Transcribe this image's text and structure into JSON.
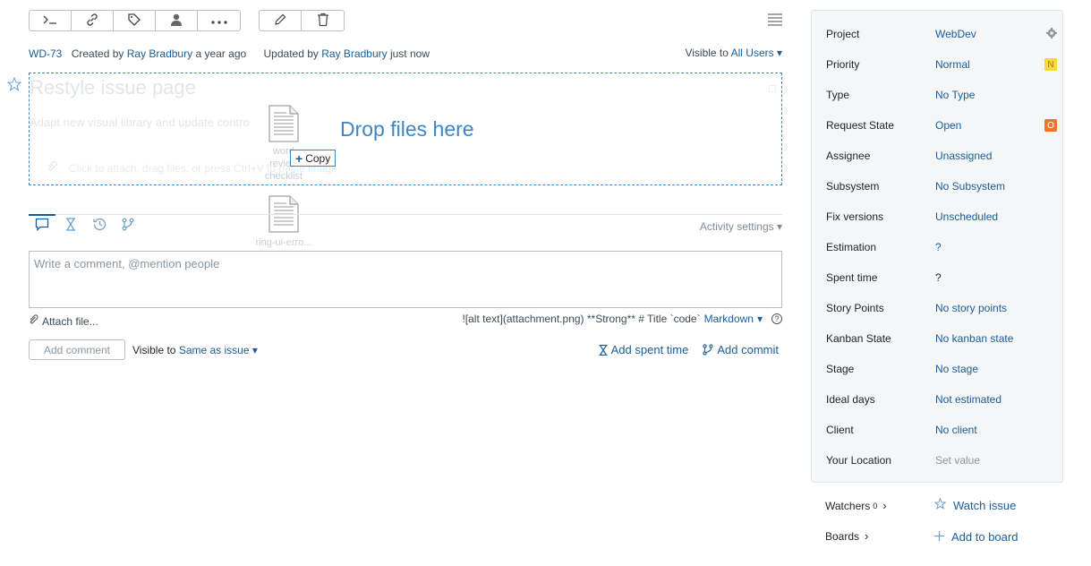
{
  "toolbar": {
    "group1": [
      "console-icon",
      "link-icon",
      "tag-icon",
      "user-icon",
      "more-icon"
    ],
    "group2": [
      "edit-icon",
      "delete-icon"
    ]
  },
  "meta": {
    "issue_id": "WD-73",
    "created_prefix": "Created by",
    "created_by": "Ray Bradbury",
    "created_when": "a year ago",
    "updated_prefix": "Updated by",
    "updated_by": "Ray Bradbury",
    "updated_when": "just now",
    "visible_prefix": "Visible to",
    "visible_to": "All Users"
  },
  "issue": {
    "title": "Restyle issue page",
    "description": "Adapt new visual library and update contro",
    "attach_hint": "Click to attach, drag files, or press Ctrl+V to paste image",
    "drop_text": "Drop files here"
  },
  "drag": {
    "file1_name": "word review checklist",
    "file2_name": "ring-ui-erro...",
    "copy_label": "Copy"
  },
  "activity": {
    "settings_label": "Activity settings",
    "tabs": [
      "comment-icon",
      "hourglass-icon",
      "history-icon",
      "vcs-icon"
    ]
  },
  "comment": {
    "placeholder": "Write a comment, @mention people",
    "attach_label": "Attach file...",
    "markdown_hint": "![alt text](attachment.png) **Strong** # Title `code`",
    "markdown_label": "Markdown",
    "add_button": "Add comment",
    "visible_prefix": "Visible to",
    "visible_to": "Same as issue",
    "add_spent_time": "Add spent time",
    "add_commit": "Add commit"
  },
  "fields": [
    {
      "label": "Project",
      "value": "WebDev"
    },
    {
      "label": "Priority",
      "value": "Normal",
      "badge": "N"
    },
    {
      "label": "Type",
      "value": "No Type"
    },
    {
      "label": "Request State",
      "value": "Open",
      "badge": "O"
    },
    {
      "label": "Assignee",
      "value": "Unassigned"
    },
    {
      "label": "Subsystem",
      "value": "No Subsystem"
    },
    {
      "label": "Fix versions",
      "value": "Unscheduled"
    },
    {
      "label": "Estimation",
      "value": "?"
    },
    {
      "label": "Spent time",
      "value": "?"
    },
    {
      "label": "Story Points",
      "value": "No story points"
    },
    {
      "label": "Kanban State",
      "value": "No kanban state"
    },
    {
      "label": "Stage",
      "value": "No stage"
    },
    {
      "label": "Ideal days",
      "value": "Not estimated"
    },
    {
      "label": "Client",
      "value": "No client"
    },
    {
      "label": "Your Location",
      "value": "Set value"
    }
  ],
  "sidebar": {
    "watchers_label": "Watchers",
    "watchers_count": "0",
    "watch_issue": "Watch issue",
    "boards_label": "Boards",
    "add_to_board": "Add to board"
  },
  "colors": {
    "link": "#1a5d99",
    "drop_zone": "#3b86c6",
    "priority_badge": "#f6d940",
    "state_badge": "#f2742b"
  }
}
